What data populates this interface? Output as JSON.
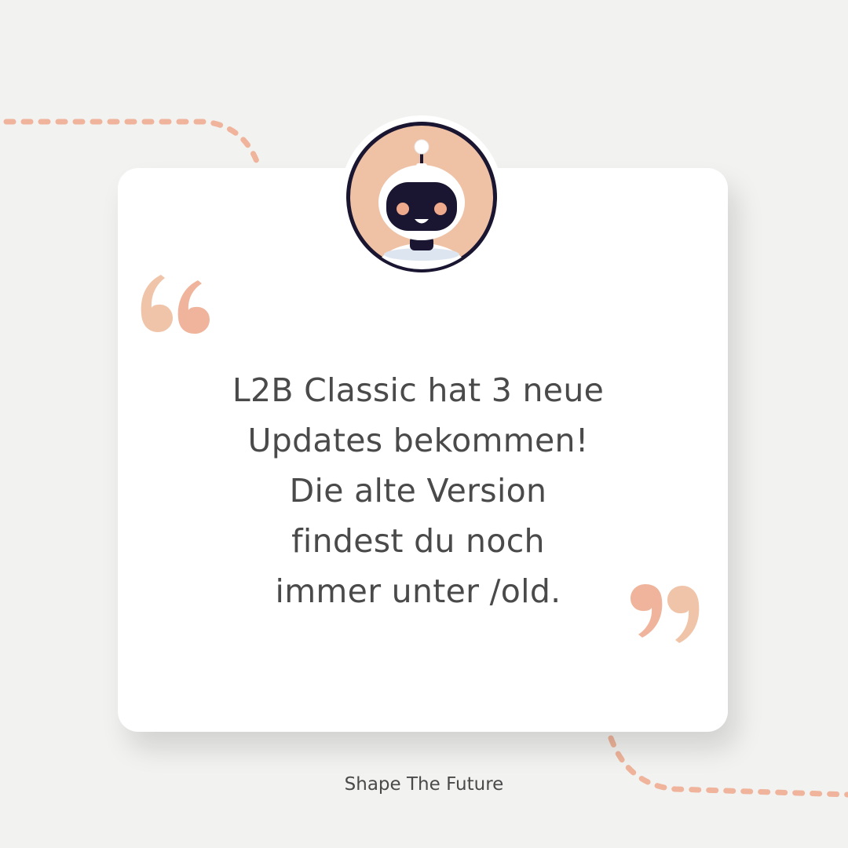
{
  "message": {
    "lines": [
      "L2B Classic hat 3 neue",
      "Updates bekommen!",
      "Die alte Version",
      "findest du noch",
      "immer unter /old."
    ]
  },
  "footer": {
    "tagline": "Shape The Future"
  },
  "icons": {
    "avatar": "robot-avatar-icon",
    "quote_open": "open-quote-icon",
    "quote_close": "close-quote-icon"
  },
  "colors": {
    "background": "#f2f2f0",
    "card": "#ffffff",
    "accent_peach": "#efb49b",
    "accent_light": "#f0c4a8",
    "text": "#4a4a4a",
    "robot_dark": "#1a1530",
    "avatar_bg": "#efc2a6"
  }
}
